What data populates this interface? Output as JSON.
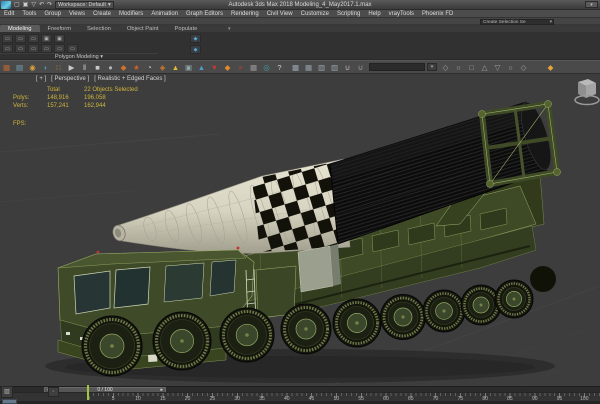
{
  "window": {
    "app_title": "Autodesk 3ds Max 2018   Modeling_4_May2017.1.max",
    "workspace": "Workspace: Default",
    "workspace_arrow": "▾",
    "infocenter_arrow": "▾"
  },
  "quick_access": {
    "icons": [
      {
        "g": "▢"
      },
      {
        "g": "▣"
      },
      {
        "g": "▽"
      },
      {
        "g": "↶"
      },
      {
        "g": "↷"
      }
    ]
  },
  "menu_bar": {
    "items": [
      {
        "label": "Edit"
      },
      {
        "label": "Tools"
      },
      {
        "label": "Group"
      },
      {
        "label": "Views"
      },
      {
        "label": "Create"
      },
      {
        "label": "Modifiers"
      },
      {
        "label": "Animation"
      },
      {
        "label": "Graph Editors"
      },
      {
        "label": "Rendering"
      },
      {
        "label": "Civil View"
      },
      {
        "label": "Customize"
      },
      {
        "label": "Scripting"
      },
      {
        "label": "Help"
      },
      {
        "label": "vrayTools"
      },
      {
        "label": "Phoenix FD"
      }
    ]
  },
  "main_toolbar": {
    "selection_set_value": "Create Selection Se",
    "dropdown_arrow": "▾"
  },
  "ribbon": {
    "tabs": [
      {
        "label": "Modeling",
        "cls": "active"
      },
      {
        "label": "Freeform"
      },
      {
        "label": "Selection"
      },
      {
        "label": "Object Paint"
      },
      {
        "label": "Populate"
      }
    ],
    "tab_overflow_arrow": "▾",
    "row1_icons": [
      {
        "g": "▭"
      },
      {
        "g": "▭"
      },
      {
        "g": "▭"
      },
      {
        "g": "▣"
      },
      {
        "g": "▣"
      }
    ],
    "row2_icons": [
      {
        "g": "▭"
      },
      {
        "g": "▭"
      },
      {
        "g": "▭"
      },
      {
        "g": "▭"
      },
      {
        "g": "▭"
      },
      {
        "g": "▭"
      }
    ],
    "blue_icons": [
      {
        "g": "◆"
      },
      {
        "g": "◆"
      }
    ],
    "section_label": "Polygon Modeling",
    "section_arrow": "▾"
  },
  "icon_toolbar": {
    "icons_a": [
      {
        "g": "▦",
        "c": "#bf6a32"
      },
      {
        "g": "▤",
        "c": "#76a8bc"
      },
      {
        "g": "◉",
        "c": "#d9a23a"
      },
      {
        "g": "◗",
        "c": "#4f9aa8"
      },
      {
        "g": "∷",
        "c": "#c98a3a"
      },
      {
        "g": "▶",
        "c": "#c9c9c9"
      },
      {
        "g": "‖",
        "c": "#c9c9c9"
      },
      {
        "g": "■",
        "c": "#c9c9c9"
      },
      {
        "g": "●",
        "c": "#b5b5b5"
      },
      {
        "g": "◆",
        "c": "#d5722a"
      },
      {
        "g": "★",
        "c": "#cf5f2e"
      },
      {
        "g": "◔",
        "c": "#cfcfcf"
      },
      {
        "g": "◈",
        "c": "#d57b2a"
      },
      {
        "g": "▲",
        "c": "#e0b83a"
      },
      {
        "g": "▣",
        "c": "#8fa7a8"
      },
      {
        "g": "▲",
        "c": "#4f9ac8"
      },
      {
        "g": "▼",
        "c": "#c03a3a"
      },
      {
        "g": "◆",
        "c": "#e08a2a"
      },
      {
        "g": "×",
        "c": "#c03a3a"
      },
      {
        "g": "▦",
        "c": "#9a9a9a"
      },
      {
        "g": "◎",
        "c": "#3f9aa8"
      },
      {
        "g": "?",
        "c": "#d0d0d0"
      }
    ],
    "icons_windows": [
      {
        "g": "▩",
        "c": "#97a4ad"
      },
      {
        "g": "▦",
        "c": "#97a4ad"
      },
      {
        "g": "▧",
        "c": "#97a4ad"
      },
      {
        "g": "▨",
        "c": "#97a4ad"
      }
    ],
    "icons_magnet": [
      {
        "g": "∪",
        "c": "#b9b9b9"
      },
      {
        "g": "∪",
        "c": "#9a9a9a"
      }
    ],
    "search_value": "",
    "mini_button": "▾",
    "icons_b": [
      {
        "g": "◇",
        "c": "#9aa0a6"
      },
      {
        "g": "○",
        "c": "#9aa0a6"
      },
      {
        "g": "□",
        "c": "#9aa0a6"
      },
      {
        "g": "△",
        "c": "#9aa0a6"
      },
      {
        "g": "▽",
        "c": "#9aa0a6"
      },
      {
        "g": "○",
        "c": "#9aa0a6"
      },
      {
        "g": "◇",
        "c": "#9aa0a6"
      }
    ],
    "shield": {
      "g": "◆",
      "c": "#e8a33a"
    }
  },
  "viewport": {
    "label_menu": "[ + ]",
    "label_pov": "[ Perspective ]",
    "label_shading": "[ Realistic + Edged Faces ]",
    "stats": {
      "header_total": "Total",
      "header_selected": "22 Objects Selected",
      "rows": [
        {
          "k": "Polys:",
          "total": "148,916",
          "sel": "196,058"
        },
        {
          "k": "Verts:",
          "total": "157,241",
          "sel": "162,944"
        }
      ],
      "fps_label": "FPS:"
    }
  },
  "timeline": {
    "prev_arrow": "◂",
    "next_arrow": "▸",
    "frame_display": "0 / 100",
    "ticks": [
      {
        "label": "0"
      },
      {
        "label": "5"
      },
      {
        "label": "10"
      },
      {
        "label": "15"
      },
      {
        "label": "20"
      },
      {
        "label": "25"
      },
      {
        "label": "30"
      },
      {
        "label": "35"
      },
      {
        "label": "40"
      },
      {
        "label": "45"
      },
      {
        "label": "50"
      },
      {
        "label": "55"
      },
      {
        "label": "60"
      },
      {
        "label": "65"
      },
      {
        "label": "70"
      },
      {
        "label": "75"
      },
      {
        "label": "80"
      },
      {
        "label": "85"
      },
      {
        "label": "90"
      },
      {
        "label": "95"
      },
      {
        "label": "100"
      }
    ],
    "left_icons": [
      {
        "g": "▧"
      },
      {
        "g": "◦"
      }
    ]
  },
  "colors": {
    "viewport_bg": "#3d3d3d",
    "stats_text": "#cdb53e",
    "playhead_green": "#9fc93f",
    "truck_green": "#3e4a26",
    "wire_green": "#9fb36b",
    "canister_black": "#0f0f0f",
    "nose_cream": "#d8d4c2"
  }
}
